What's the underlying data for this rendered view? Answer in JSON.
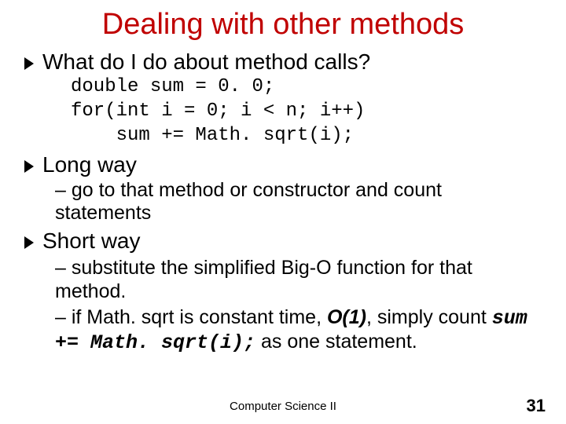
{
  "title": "Dealing with other methods",
  "b1": "What do I do about method calls?",
  "code1": "double sum = 0. 0;",
  "code2": "for(int i = 0; i < n; i++)",
  "code3": "    sum += Math. sqrt(i);",
  "b2": "Long way",
  "s2a": "– go to that method or constructor and count statements",
  "b3": "Short way",
  "s3a": "– substitute the simplified Big-O function for that method.",
  "s3b_pre": "– if Math. sqrt is constant time, ",
  "s3b_o1": "O(1)",
  "s3b_mid": ", simply count ",
  "s3b_code": "sum += Math. sqrt(i);",
  "s3b_post": " as one statement.",
  "footer": "Computer Science II",
  "page": "31"
}
